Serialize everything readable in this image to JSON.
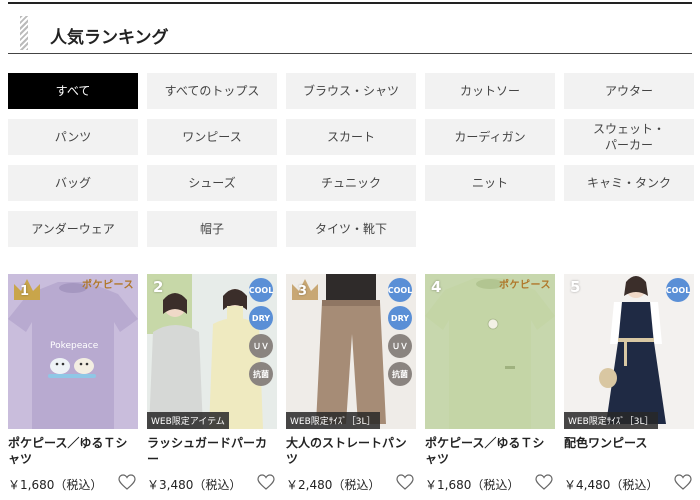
{
  "header": {
    "title": "人気ランキング"
  },
  "categories": [
    {
      "label": "すべて",
      "active": true
    },
    {
      "label": "すべてのトップス"
    },
    {
      "label": "ブラウス・シャツ"
    },
    {
      "label": "カットソー"
    },
    {
      "label": "アウター"
    },
    {
      "label": "パンツ"
    },
    {
      "label": "ワンピース"
    },
    {
      "label": "スカート"
    },
    {
      "label": "カーディガン"
    },
    {
      "label": "スウェット・\nパーカー"
    },
    {
      "label": "バッグ"
    },
    {
      "label": "シューズ"
    },
    {
      "label": "チュニック"
    },
    {
      "label": "ニット"
    },
    {
      "label": "キャミ・タンク"
    },
    {
      "label": "アンダーウェア"
    },
    {
      "label": "帽子"
    },
    {
      "label": "タイツ・靴下"
    }
  ],
  "products": [
    {
      "rank": "1",
      "name": "ポケピース／ゆるＴシャツ",
      "price": "￥1,680（税込）",
      "brand": "ポケピース",
      "tag": "",
      "badges": []
    },
    {
      "rank": "2",
      "name": "ラッシュガードパーカー",
      "price": "￥3,480（税込）",
      "brand": "",
      "tag": "WEB限定アイテム",
      "badges": [
        "COOL",
        "DRY",
        "ＵＶ",
        "抗菌"
      ]
    },
    {
      "rank": "3",
      "name": "大人のストレートパンツ",
      "price": "￥2,480（税込）",
      "brand": "",
      "tag": "WEB限定ｻｲｽﾞ［3L］",
      "badges": [
        "COOL",
        "DRY",
        "ＵＶ",
        "抗菌"
      ]
    },
    {
      "rank": "4",
      "name": "ポケピース／ゆるＴシャツ",
      "price": "￥1,680（税込）",
      "brand": "ポケピース",
      "tag": "",
      "badges": []
    },
    {
      "rank": "5",
      "name": "配色ワンピース",
      "price": "￥4,480（税込）",
      "brand": "",
      "tag": "WEB限定ｻｲｽﾞ［3L］",
      "badges": [
        "COOL"
      ]
    }
  ],
  "colors": {
    "badge_blue": "#5a8fd6",
    "badge_gray": "#8a8480",
    "gold": "#c9a54a"
  }
}
